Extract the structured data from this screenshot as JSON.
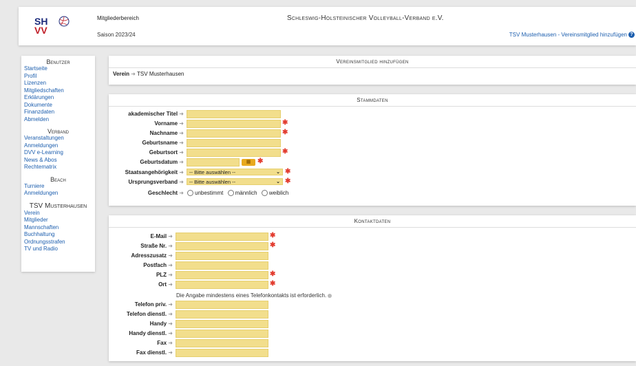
{
  "header": {
    "logo_text_top": "SH",
    "logo_text_bottom": "VV",
    "logo_small": "Schleswig-Holsteinischer Volleyball-Verband",
    "area": "Mitgliederbereich",
    "season": "Saison 2023/24",
    "title": "Schleswig-Holsteinischer Volleyball-Verband e.V.",
    "breadcrumb": "TSV Musterhausen - Vereinsmitglied hinzufügen",
    "help_label": "?"
  },
  "sidebar": {
    "sections": [
      {
        "title": "Benutzer",
        "items": [
          "Startseite",
          "Profil",
          "Lizenzen",
          "Mitgliedschaften",
          "Erklärungen",
          "Dokumente",
          "Finanzdaten",
          "Abmelden"
        ]
      },
      {
        "title": "Verband",
        "items": [
          "Veranstaltungen",
          "Anmeldungen",
          "DVV e-Learning",
          "News & Abos",
          "Rechtematrix"
        ]
      },
      {
        "title": "Beach",
        "items": [
          "Turniere",
          "Anmeldungen"
        ]
      },
      {
        "title": "TSV Musterhausen",
        "items": [
          "Verein",
          "Mitglieder",
          "Mannschaften",
          "Buchhaltung",
          "Ordnungsstrafen",
          "TV und Radio"
        ]
      }
    ]
  },
  "verein_panel": {
    "title": "Vereinsmitglied hinzufügen",
    "label": "Verein",
    "value": "TSV Musterhausen"
  },
  "stammdaten": {
    "title": "Stammdaten",
    "fields": {
      "titel": "akademischer Titel",
      "vorname": "Vorname",
      "nachname": "Nachname",
      "geburtsname": "Geburtsname",
      "geburtsort": "Geburtsort",
      "geburtsdatum": "Geburtsdatum",
      "staat": "Staatsangehörigkeit",
      "verband": "Ursprungsverband",
      "geschlecht": "Geschlecht"
    },
    "select_placeholder": "-- Bitte auswählen --",
    "gender_options": [
      "unbestimmt",
      "männlich",
      "weiblich"
    ]
  },
  "kontaktdaten": {
    "title": "Kontaktdaten",
    "fields": {
      "email": "E-Mail",
      "strasse": "Straße Nr.",
      "adresszusatz": "Adresszusatz",
      "postfach": "Postfach",
      "plz": "PLZ",
      "ort": "Ort",
      "tel_priv": "Telefon priv.",
      "tel_dienst": "Telefon dienstl.",
      "handy": "Handy",
      "handy_dienst": "Handy dienstl.",
      "fax": "Fax",
      "fax_dienst": "Fax dienstl."
    },
    "phone_note": "Die Angabe mindestens eines Telefonkontakts ist erforderlich."
  },
  "colors": {
    "input_bg": "#f2de8c",
    "required": "#e23b2e",
    "link": "#1c5eae"
  }
}
